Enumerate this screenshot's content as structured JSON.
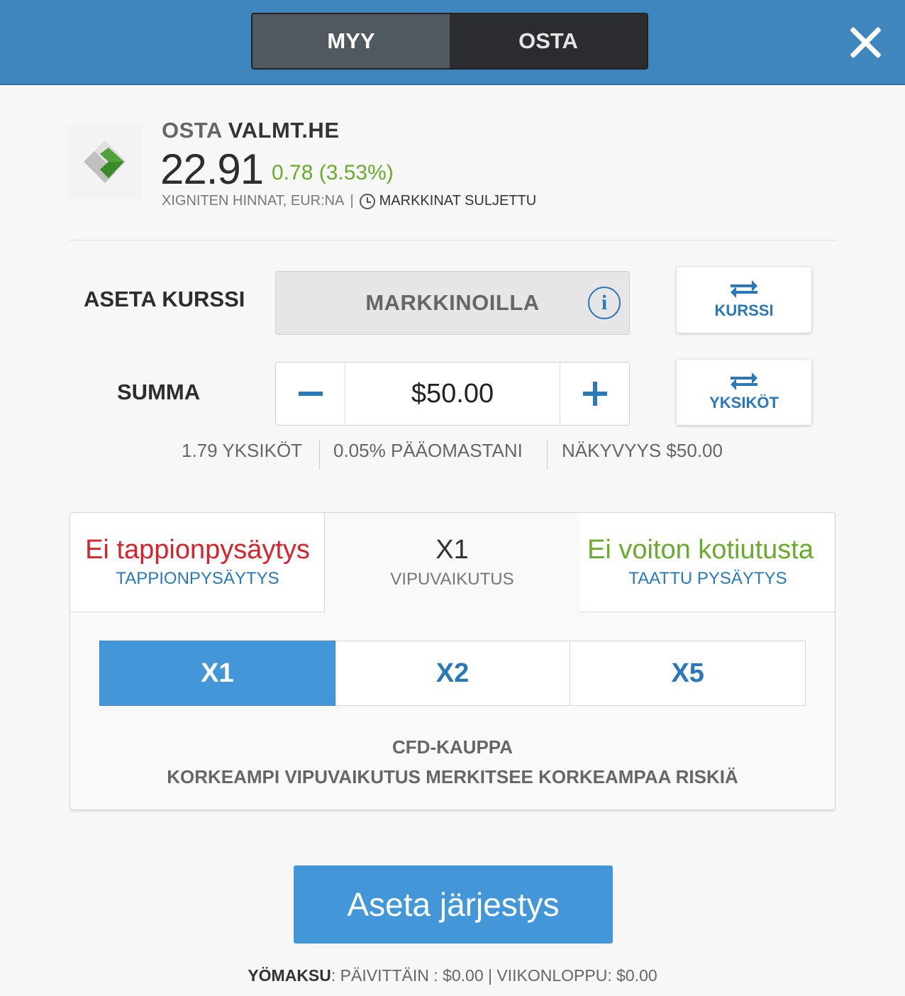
{
  "header": {
    "sell_label": "MYY",
    "buy_label": "OSTA",
    "close_icon": "close-icon"
  },
  "instrument": {
    "action": "OSTA",
    "symbol": "VALMT.HE",
    "price": "22.91",
    "change": "0.78 (3.53%)",
    "source": "XIGNITEN HINNAT, EUR:NA",
    "separator": "|",
    "market_status": "MARKKINAT SULJETTU",
    "colors": {
      "change": "#6aaa2d"
    }
  },
  "rate": {
    "label": "ASETA KURSSI",
    "value": "MARKKINOILLA",
    "info_symbol": "i",
    "switch_label": "KURSSI"
  },
  "amount": {
    "label": "SUMMA",
    "value": "$50.00",
    "switch_label": "YKSIKÖT",
    "units": "1.79 YKSIKÖT",
    "equity": "0.05% PÄÄOMASTANI",
    "exposure": "NÄKYVYYS $50.00"
  },
  "tabs": {
    "stop_loss": {
      "value": "Ei tappionpysäytys",
      "label": "TAPPIONPYSÄYTYS",
      "color": "#d9232b"
    },
    "leverage": {
      "value": "X1",
      "label": "VIPUVAIKUTUS"
    },
    "take_profit": {
      "value": "Ei voiton kotiutusta",
      "label": "TAATTU PYSÄYTYS",
      "color": "#6aaa2d"
    }
  },
  "leverage_options": [
    {
      "label": "X1",
      "selected": true
    },
    {
      "label": "X2",
      "selected": false
    },
    {
      "label": "X5",
      "selected": false
    }
  ],
  "cfd": {
    "title": "CFD-KAUPPA",
    "warning": "KORKEAMPI VIPUVAIKUTUS MERKITSEE KORKEAMPAA RISKIÄ"
  },
  "submit_label": "Aseta järjestys",
  "fees": {
    "title": "YÖMAKSU",
    "colon": ":",
    "daily": "PÄIVITTÄIN : $0.00",
    "separator": "|",
    "weekend": "VIIKONLOPPU: $0.00"
  },
  "colors": {
    "accent": "#4397d9",
    "link": "#2a78b8",
    "header": "#3e86bd"
  }
}
